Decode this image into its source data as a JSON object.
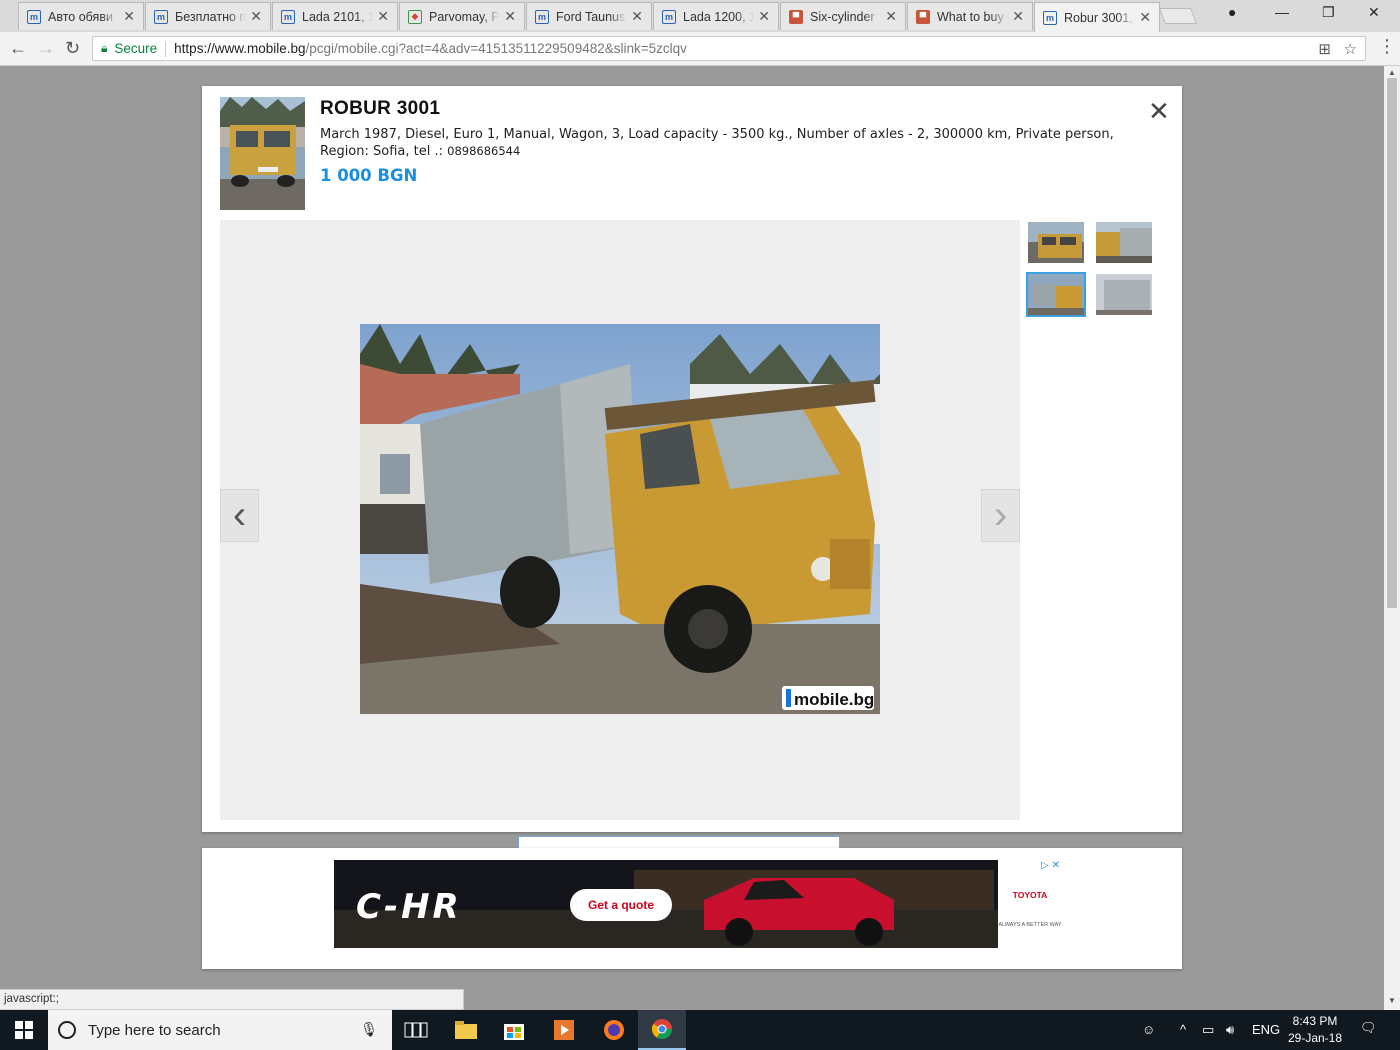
{
  "browser": {
    "tabs": [
      {
        "title": "Авто обяви",
        "favicon": "mobile-bg-icon"
      },
      {
        "title": "Безплатно п",
        "favicon": "mobile-bg-icon"
      },
      {
        "title": "Lada 2101, 1",
        "favicon": "mobile-bg-icon"
      },
      {
        "title": "Parvomay, P",
        "favicon": "maps-icon"
      },
      {
        "title": "Ford Taunus",
        "favicon": "mobile-bg-icon"
      },
      {
        "title": "Lada 1200, 1",
        "favicon": "mobile-bg-icon"
      },
      {
        "title": "Six-cylinder",
        "favicon": "red-site-icon"
      },
      {
        "title": "What to buy",
        "favicon": "red-site-icon"
      },
      {
        "title": "Robur 3001,",
        "favicon": "mobile-bg-icon",
        "active": true
      }
    ],
    "secure_label": "Secure",
    "url_host": "https://www.mobile.bg",
    "url_rest": "/pcgi/mobile.cgi?act=4&adv=41513511229509482&slink=5zclqv",
    "status_text": "javascript:;"
  },
  "ad": {
    "title": "ROBUR 3001",
    "description": "March 1987, Diesel, Euro 1, Manual, Wagon, 3, Load capacity - 3500 kg., Number of axles - 2, 300000 km, Private person, Region: Sofia, tel .:",
    "phone": "0898686544",
    "price": "1 000 BGN",
    "close_symbol": "✕",
    "prev_symbol": "‹",
    "next_symbol": "›",
    "watermark": "mobile.bg",
    "thumbnails": [
      {
        "selected": false
      },
      {
        "selected": false
      },
      {
        "selected": true
      },
      {
        "selected": false
      }
    ]
  },
  "banner": {
    "model": "C-HR",
    "cta": "Get a quote",
    "brand": "TOYOTA",
    "slogan": "ALWAYS A BETTER WAY",
    "adchoice": "▷ ✕"
  },
  "taskbar": {
    "search_placeholder": "Type here to search",
    "language": "ENG",
    "time": "8:43 PM",
    "date": "29-Jan-18"
  },
  "colors": {
    "price": "#1a8fe0",
    "secure": "#0b8043",
    "selected_thumb": "#3aa0e0"
  }
}
